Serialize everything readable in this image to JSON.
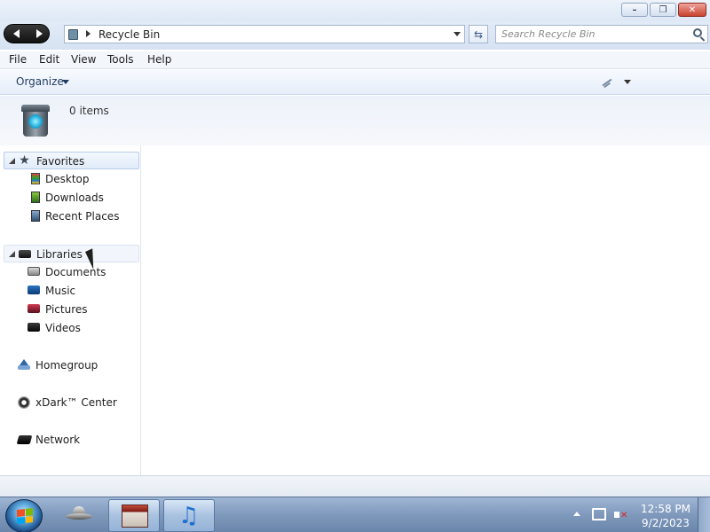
{
  "window": {
    "minimize_glyph": "–",
    "maximize_glyph": "❐",
    "close_glyph": "✕"
  },
  "address": {
    "path": "Recycle Bin",
    "search_placeholder": "Search Recycle Bin"
  },
  "menu": [
    "File",
    "Edit",
    "View",
    "Tools",
    "Help"
  ],
  "toolbar": {
    "organize_label": "Organize"
  },
  "info": {
    "items_count": "0 items"
  },
  "nav": {
    "favorites": {
      "label": "Favorites",
      "items": [
        "Desktop",
        "Downloads",
        "Recent Places"
      ]
    },
    "libraries": {
      "label": "Libraries",
      "items": [
        "Documents",
        "Music",
        "Pictures",
        "Videos"
      ]
    },
    "homegroup": "Homegroup",
    "xdark": "xDark™ Center",
    "network": "Network"
  },
  "taskbar": {
    "time": "12:58 PM",
    "date": "9/2/2023"
  },
  "icons": {
    "start": "windows-start-orb",
    "pinned_1": "ufo-app-icon",
    "pinned_2": "explorer-shop-icon",
    "pinned_3": "music-note-icon"
  }
}
